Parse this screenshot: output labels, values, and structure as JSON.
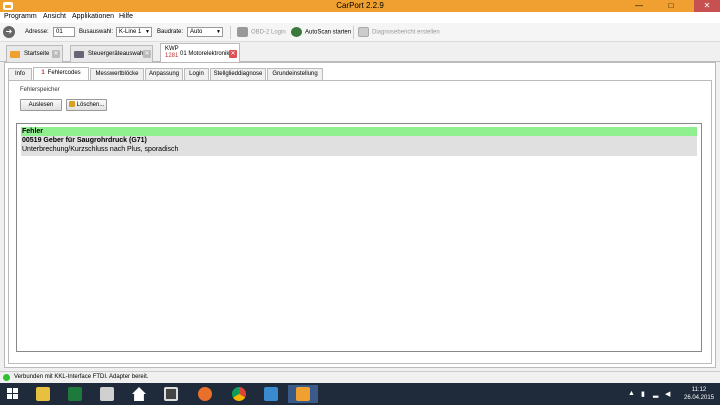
{
  "window": {
    "title": "CarPort 2.2.9",
    "minimize": "—",
    "maximize": "□",
    "close": "✕"
  },
  "menu": [
    "Programm",
    "Ansicht",
    "Applikationen",
    "Hilfe"
  ],
  "toolbar": {
    "adresse_label": "Adresse:",
    "adresse_value": "01",
    "bus_label": "Busauswahl:",
    "bus_value": "K-Line 1",
    "baud_label": "Baudrate:",
    "baud_value": "Auto",
    "obd_login": "OBD-2 Login",
    "autoscan": "AutoScan starten",
    "diagnose": "Diagnosebericht erstellen"
  },
  "doc_tabs": {
    "startseite": "Startseite",
    "steuergeraete": "Steuergeräteauswahl",
    "kwp_label": "KWP",
    "kwp_number": "1281",
    "motor": "01 Motorelektronik"
  },
  "sub_tabs": {
    "info": "Info",
    "fehlercodes_count": "1",
    "fehlercodes": "Fehlercodes",
    "messwert": "Messwertblöcke",
    "anpassung": "Anpassung",
    "login": "Login",
    "stellglied": "Stellglieddiagnose",
    "grund": "Grundeinstellung"
  },
  "fehlerspeicher": {
    "label": "Fehlerspeicher",
    "auslesen": "Auslesen",
    "loeschen": "Löschen..."
  },
  "errors": {
    "header": "Fehler",
    "items": [
      {
        "code": "00519 Geber für Saugrohrdruck (G71)",
        "desc": "Unterbrechung/Kurzschluss nach Plus, sporadisch"
      }
    ]
  },
  "status": "Verbunden mit KKL-Interface FTDI. Adapter bereit.",
  "taskbar": {
    "time": "11:12",
    "date": "26.04.2015"
  }
}
